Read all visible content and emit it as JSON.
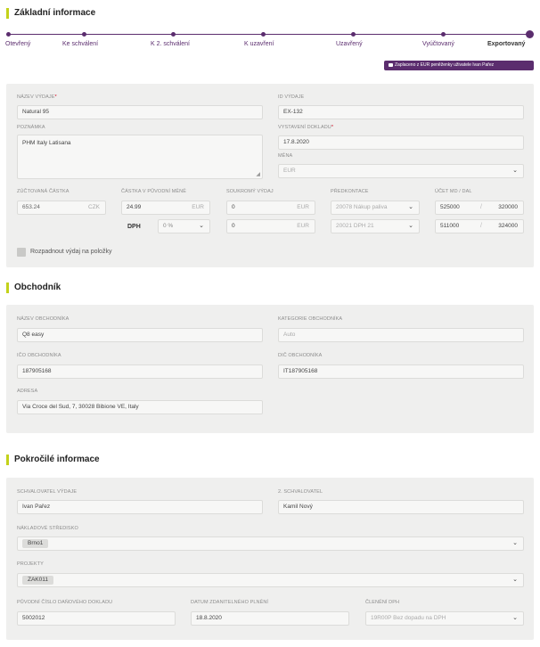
{
  "sections": {
    "basic": "Základní informace",
    "merchant": "Obchodník",
    "advanced": "Pokročilé informace"
  },
  "steps": [
    "Otevřený",
    "Ke schválení",
    "K 2. schválení",
    "K uzavření",
    "Uzavřený",
    "Vyúčtovaný",
    "Exportovaný"
  ],
  "paid_badge": "Zaplaceno z EUR peněženky uživatele Ivan Pařez",
  "basic": {
    "expense_name_label": "Název výdaje",
    "expense_name": "Natural 95",
    "expense_id_label": "ID výdaje",
    "expense_id": "EX-132",
    "note_label": "Poznámka",
    "note": "PHM Italy Latisana",
    "issued_label": "Vystavení dokladu",
    "issued": "17.8.2020",
    "currency_label": "Měna",
    "currency": "EUR",
    "settled_label": "Zúčtovaná částka",
    "settled_amount": "653.24",
    "settled_currency": "CZK",
    "original_label": "Částka v původní měně",
    "original_amount": "24.99",
    "original_currency": "EUR",
    "private_label": "Soukromý výdaj",
    "private_amount": "0",
    "private_currency": "EUR",
    "vat_label": "DPH",
    "vat_rate": "0 %",
    "vat_amount": "0",
    "vat_currency": "EUR",
    "precontact_label": "Předkontace",
    "precontact_1": "20078 Nákup paliva",
    "precontact_2": "20021 DPH 21",
    "account_label": "Účet MD / DAL",
    "md_1": "525000",
    "dal_1": "320000",
    "md_2": "511000",
    "dal_2": "324000",
    "split_label": "Rozpadnout výdaj na položky"
  },
  "merchant": {
    "name_label": "Název obchodníka",
    "name": "Q8 easy",
    "category_label": "Kategorie obchodníka",
    "category": "Auto",
    "ico_label": "IČO obchodníka",
    "ico": "187905168",
    "dic_label": "DIČ obchodníka",
    "dic": "IT187905168",
    "address_label": "Adresa",
    "address": "Via Croce del Sud, 7, 30028 Bibione VE, Italy"
  },
  "advanced": {
    "approver_label": "Schvalovatel výdaje",
    "approver": "Ivan Pařez",
    "approver2_label": "2. schvalovatel",
    "approver2": "Kamil Nový",
    "cost_center_label": "Nákladové středisko",
    "cost_center": "Brno1",
    "projects_label": "Projekty",
    "project": "ZAK011",
    "orig_doc_label": "Původní číslo daňového dokladu",
    "orig_doc": "5002012",
    "taxable_date_label": "Datum zdanitelného plnění",
    "taxable_date": "18.8.2020",
    "vat_class_label": "Členění DPH",
    "vat_class": "19R00P Bez dopadu na DPH"
  }
}
